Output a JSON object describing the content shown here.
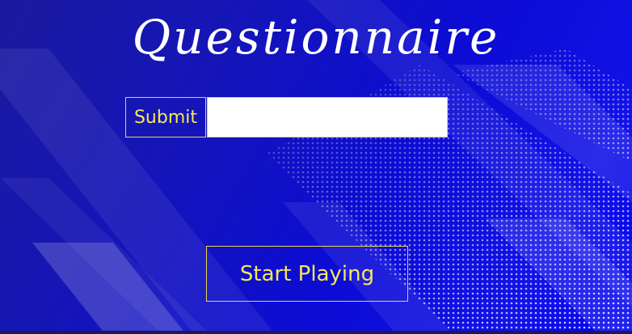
{
  "window": {
    "title": "Questionnaire"
  },
  "form": {
    "submit_label": "Submit",
    "answer_value": "",
    "answer_placeholder": ""
  },
  "actions": {
    "start_label": "Start Playing"
  },
  "colors": {
    "background_start": "#1a1a9e",
    "background_end": "#0000f0",
    "title_text": "#ffffff",
    "button_text": "#f5e85a",
    "button_border": "#e8d44a",
    "input_background": "#ffffff"
  }
}
